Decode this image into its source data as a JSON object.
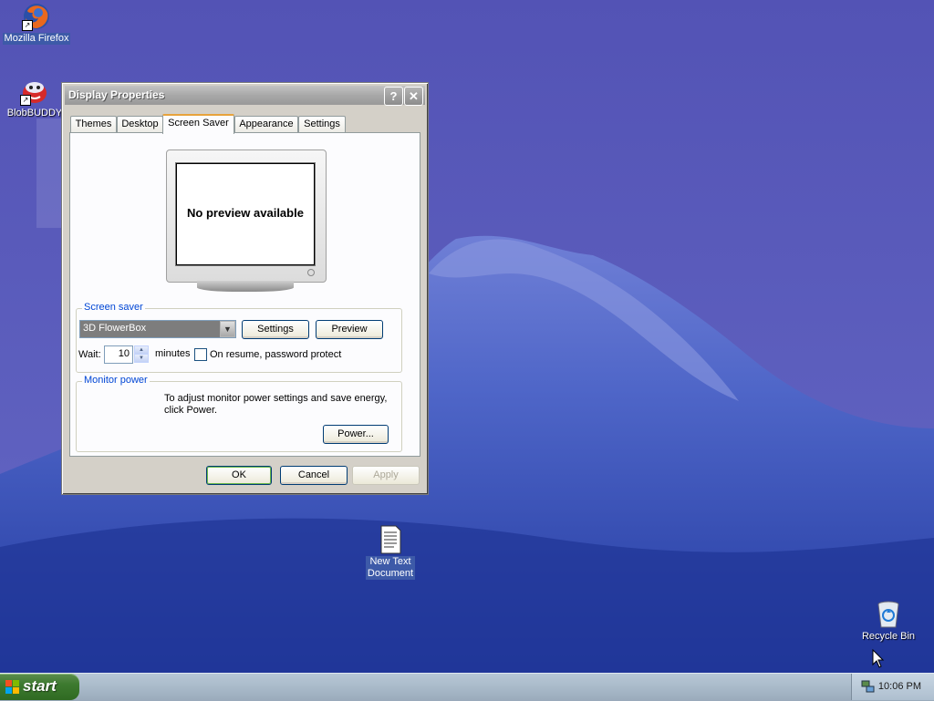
{
  "desktop": {
    "icons": [
      {
        "label": "Mozilla Firefox",
        "icon": "firefox-icon"
      },
      {
        "label": "BlobBUDDY",
        "icon": "blobbuddy-icon"
      },
      {
        "label_line1": "New Text",
        "label_line2": "Document",
        "icon": "text-document-icon"
      },
      {
        "label": "Recycle Bin",
        "icon": "recycle-bin-icon"
      }
    ]
  },
  "window": {
    "title": "Display Properties",
    "help_glyph": "?",
    "close_glyph": "✕",
    "tabs": [
      {
        "label": "Themes",
        "active": false
      },
      {
        "label": "Desktop",
        "active": false
      },
      {
        "label": "Screen Saver",
        "active": true
      },
      {
        "label": "Appearance",
        "active": false
      },
      {
        "label": "Settings",
        "active": false
      }
    ],
    "preview_text": "No preview available",
    "screen_saver": {
      "group_label": "Screen saver",
      "selected": "3D FlowerBox",
      "settings_label": "Settings",
      "preview_label": "Preview",
      "wait_label": "Wait:",
      "wait_value": "10",
      "minutes_label": "minutes",
      "password_label": "On resume, password protect",
      "password_checked": false
    },
    "monitor_power": {
      "group_label": "Monitor power",
      "description_line1": "To adjust monitor power settings and save energy,",
      "description_line2": "click Power.",
      "power_label": "Power..."
    },
    "buttons": {
      "ok": "OK",
      "cancel": "Cancel",
      "apply": "Apply"
    }
  },
  "taskbar": {
    "start_label": "start",
    "clock": "10:06 PM"
  },
  "colors": {
    "accent_tab": "#e7a33c",
    "group_label": "#0046d5",
    "start_green": "#3d7a2f"
  }
}
